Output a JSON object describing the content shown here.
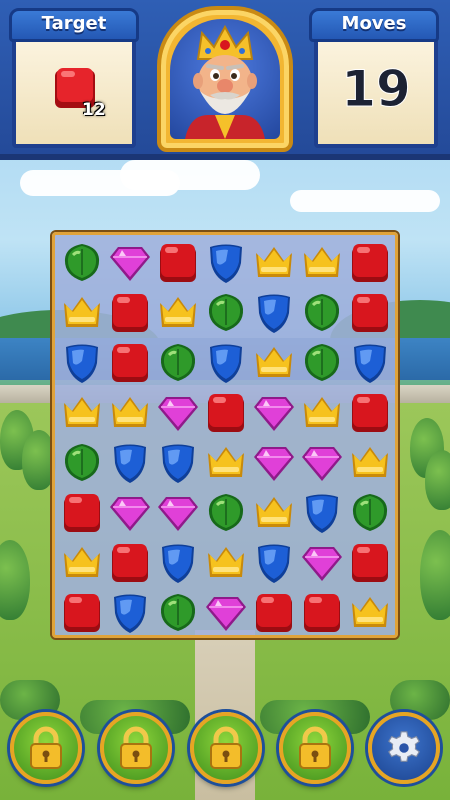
{
  "hud": {
    "target_title": "Target",
    "target_count": "12",
    "target_piece": "red-block",
    "moves_title": "Moves",
    "moves_value": "19",
    "avatar": "king-portrait"
  },
  "board": {
    "rows": [
      [
        "green-leaf",
        "pink-gem",
        "red-block",
        "blue-shield",
        "yellow-crown",
        "yellow-crown",
        "red-block"
      ],
      [
        "yellow-crown",
        "red-block",
        "yellow-crown",
        "green-leaf",
        "blue-shield",
        "green-leaf",
        "red-block"
      ],
      [
        "blue-shield",
        "red-block",
        "green-leaf",
        "blue-shield",
        "yellow-crown",
        "green-leaf",
        "blue-shield"
      ],
      [
        "yellow-crown",
        "yellow-crown",
        "pink-gem",
        "red-block",
        "pink-gem",
        "yellow-crown",
        "red-block"
      ],
      [
        "green-leaf",
        "blue-shield",
        "blue-shield",
        "yellow-crown",
        "pink-gem",
        "pink-gem",
        "yellow-crown"
      ],
      [
        "red-block",
        "pink-gem",
        "pink-gem",
        "green-leaf",
        "yellow-crown",
        "blue-shield",
        "green-leaf"
      ],
      [
        "yellow-crown",
        "red-block",
        "blue-shield",
        "yellow-crown",
        "blue-shield",
        "pink-gem",
        "red-block"
      ],
      [
        "red-block",
        "blue-shield",
        "green-leaf",
        "pink-gem",
        "red-block",
        "red-block",
        "yellow-crown"
      ]
    ]
  },
  "boosters": [
    {
      "icon": "padlock-icon",
      "state": "locked"
    },
    {
      "icon": "padlock-icon",
      "state": "locked"
    },
    {
      "icon": "padlock-icon",
      "state": "locked"
    },
    {
      "icon": "padlock-icon",
      "state": "locked"
    }
  ],
  "settings": {
    "icon": "gear-icon"
  },
  "colors": {
    "hud_blue": "#2f5fb5",
    "gold": "#e6a524",
    "red": "#d8161e",
    "blue": "#1d5fd6",
    "green": "#2f9a2a",
    "yellow": "#f6c21e",
    "pink": "#e040d8"
  }
}
